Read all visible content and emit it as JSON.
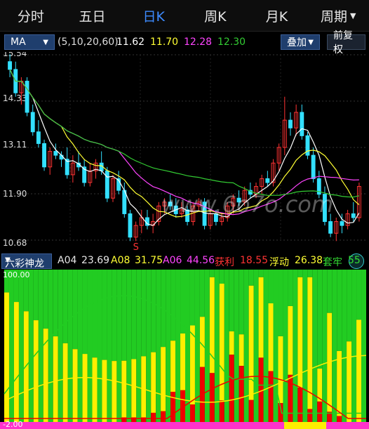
{
  "tabs": [
    {
      "label": "分时",
      "active": false
    },
    {
      "label": "五日",
      "active": false
    },
    {
      "label": "日K",
      "active": true
    },
    {
      "label": "周K",
      "active": false
    },
    {
      "label": "月K",
      "active": false
    },
    {
      "label": "周期",
      "active": false,
      "dropdown": true
    }
  ],
  "ma_bar": {
    "indicator": "MA",
    "params": "(5,10,20,60)",
    "values": [
      {
        "value": "11.62",
        "color": "#ffffff"
      },
      {
        "value": "11.70",
        "color": "#ffff33"
      },
      {
        "value": "12.28",
        "color": "#ff44ff"
      },
      {
        "value": "12.30",
        "color": "#33cc33"
      }
    ],
    "overlay_label": "叠加",
    "fq_label": "前复权"
  },
  "price_axis": [
    "15.54",
    "14.33",
    "13.11",
    "11.90",
    "10.68"
  ],
  "signal_marker": "S",
  "watermark": "www.6o7o.com",
  "indicator_bar": {
    "name": "六彩神龙",
    "items": [
      {
        "label": "A04",
        "value": "23.69",
        "color": "#e6e6e6"
      },
      {
        "label": "A08",
        "value": "31.75",
        "color": "#ffff33"
      },
      {
        "label": "A06",
        "value": "44.56",
        "color": "#ff44ff"
      },
      {
        "label": "获利",
        "value": "18.55",
        "color": "#ff3333"
      },
      {
        "label": "浮动",
        "value": "26.38",
        "color": "#ffff33"
      },
      {
        "label": "套牢",
        "value": "55",
        "color": "#33dd33"
      }
    ]
  },
  "indicator_axis": [
    "100.00",
    "-2.00"
  ],
  "colors": {
    "up": "#ff3333",
    "down": "#33e0ff",
    "ma5": "#ffffff",
    "ma10": "#ffff33",
    "ma20": "#ff44ff",
    "ma60": "#33cc33",
    "bar_green": "#22cc22",
    "bar_yellow": "#ffee00",
    "bar_red": "#ee0000"
  }
}
